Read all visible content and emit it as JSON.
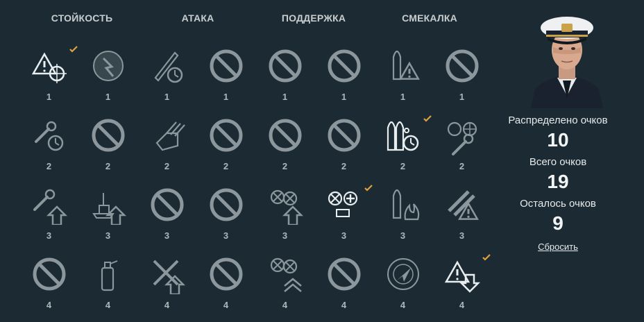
{
  "columns": [
    "СТОЙКОСТЬ",
    "АТАКА",
    "ПОДДЕРЖКА",
    "СМЕКАЛКА"
  ],
  "colors": {
    "background": "#1c2b33",
    "icon_active": "#e8eef0",
    "icon_inactive": "#8b979c",
    "checkmark": "#e0a23c"
  },
  "rows": [
    {
      "tier": "1",
      "skills": [
        {
          "icon": "warning-crosshair-icon",
          "state": "selected"
        },
        {
          "icon": "torpedo-boat-icon",
          "state": "available"
        },
        {
          "icon": "shell-timer-icon",
          "state": "available"
        },
        {
          "icon": "locked-icon",
          "state": "locked"
        },
        {
          "icon": "locked-icon",
          "state": "locked"
        },
        {
          "icon": "locked-icon",
          "state": "locked"
        },
        {
          "icon": "shell-warning-icon",
          "state": "available"
        },
        {
          "icon": "locked-icon",
          "state": "locked"
        }
      ]
    },
    {
      "tier": "2",
      "skills": [
        {
          "icon": "wrench-timer-icon",
          "state": "available"
        },
        {
          "icon": "locked-icon",
          "state": "locked"
        },
        {
          "icon": "turret-icon",
          "state": "available"
        },
        {
          "icon": "locked-icon",
          "state": "locked"
        },
        {
          "icon": "locked-icon",
          "state": "locked"
        },
        {
          "icon": "locked-icon",
          "state": "locked"
        },
        {
          "icon": "shells-timer-icon",
          "state": "selected"
        },
        {
          "icon": "fan-gear-wrench-icon",
          "state": "available"
        }
      ]
    },
    {
      "tier": "3",
      "skills": [
        {
          "icon": "wrench-arrow-up-icon",
          "state": "available"
        },
        {
          "icon": "ship-arrow-up-icon",
          "state": "available"
        },
        {
          "icon": "locked-icon",
          "state": "locked"
        },
        {
          "icon": "locked-icon",
          "state": "locked"
        },
        {
          "icon": "aa-arrow-up-icon",
          "state": "available"
        },
        {
          "icon": "aa-plus-icon",
          "state": "selected"
        },
        {
          "icon": "shell-fire-icon",
          "state": "available"
        },
        {
          "icon": "shells-warning-icon",
          "state": "available"
        }
      ]
    },
    {
      "tier": "4",
      "skills": [
        {
          "icon": "locked-icon",
          "state": "locked"
        },
        {
          "icon": "extinguisher-icon",
          "state": "available"
        },
        {
          "icon": "aircraft-arrow-up-icon",
          "state": "available"
        },
        {
          "icon": "locked-icon",
          "state": "locked"
        },
        {
          "icon": "aa-double-arrow-icon",
          "state": "available"
        },
        {
          "icon": "locked-icon",
          "state": "locked"
        },
        {
          "icon": "radar-icon",
          "state": "available"
        },
        {
          "icon": "warning-arrow-down-icon",
          "state": "selected"
        }
      ]
    }
  ],
  "commander": {
    "portrait": "commander-portrait"
  },
  "stats": {
    "distributed_label": "Распределено очков",
    "distributed_value": "10",
    "total_label": "Всего очков",
    "total_value": "19",
    "remaining_label": "Осталось очков",
    "remaining_value": "9"
  },
  "reset_label": "Сбросить"
}
